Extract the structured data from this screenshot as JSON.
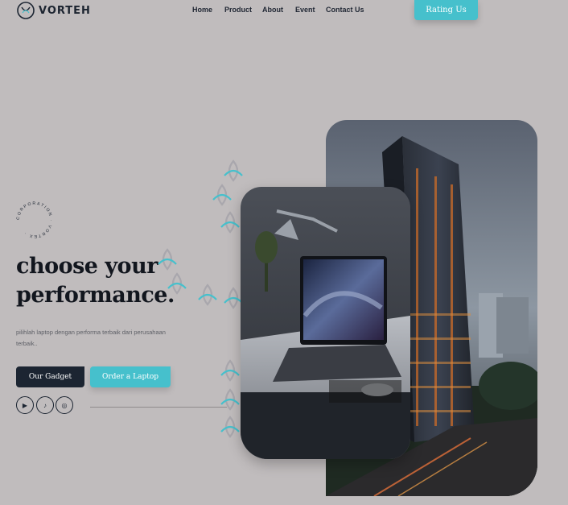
{
  "brand": {
    "name": "VORTEH"
  },
  "nav": {
    "items": [
      "Home",
      "Product",
      "About",
      "Event",
      "Contact Us"
    ]
  },
  "header": {
    "rating_label": "Rating Us"
  },
  "badge": {
    "ring_text": "CORPORATION · VORTEX ·"
  },
  "hero": {
    "title_line1": "choose your",
    "title_line2": "performance",
    "title_dot": ".",
    "description": "pilihlah laptop dengan performa terbaik dari perusahaan terbaik.."
  },
  "buttons": {
    "primary": "Our Gadget",
    "secondary": "Order a Laptop"
  },
  "social": [
    {
      "icon": "youtube-icon",
      "glyph": "▶"
    },
    {
      "icon": "tiktok-icon",
      "glyph": "♪"
    },
    {
      "icon": "instagram-icon",
      "glyph": "◎"
    }
  ],
  "colors": {
    "background": "#c0bcbd",
    "accent": "#46c0cc",
    "dark": "#1c2532"
  }
}
